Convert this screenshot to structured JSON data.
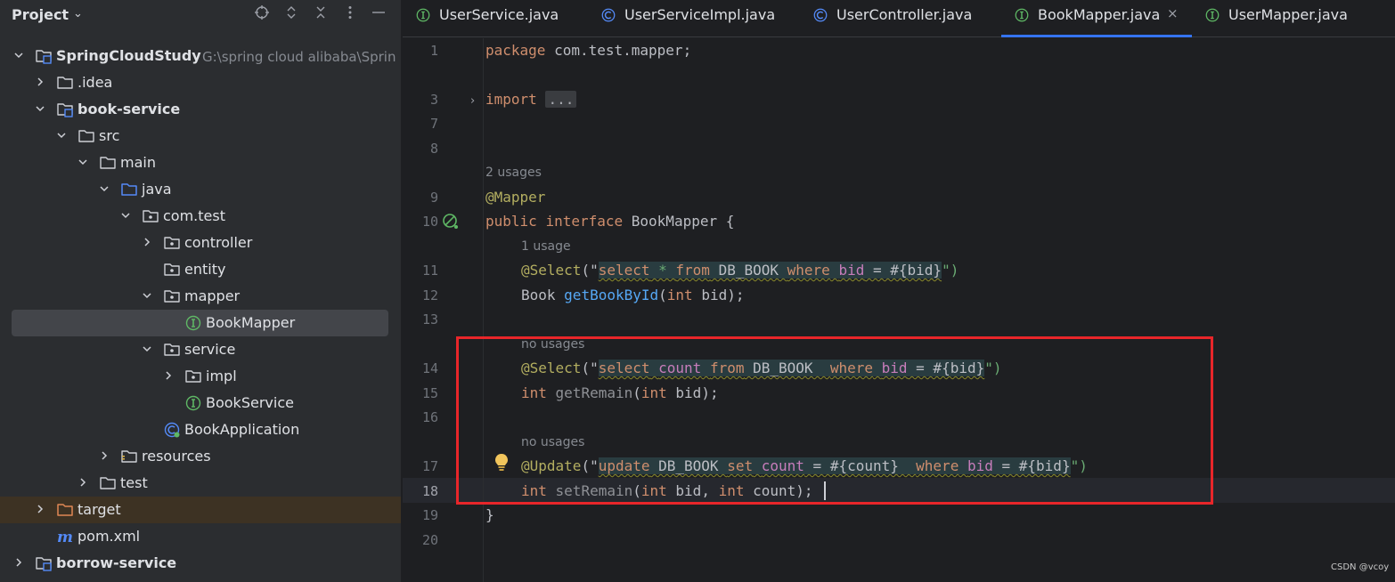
{
  "project_panel": {
    "title": "Project",
    "header_icons": [
      "locate-icon",
      "expand-all-icon",
      "collapse-all-icon",
      "more-options-icon",
      "hide-panel-icon"
    ],
    "tree": [
      {
        "label": "SpringCloudStudy",
        "path": "G:\\spring cloud alibaba\\Sprin",
        "icon": "module-folder-icon",
        "expanded": true,
        "bold": true
      },
      {
        "label": ".idea",
        "icon": "folder-icon",
        "expanded": false
      },
      {
        "label": "book-service",
        "icon": "module-folder-icon",
        "expanded": true,
        "bold": true
      },
      {
        "label": "src",
        "icon": "folder-icon",
        "expanded": true
      },
      {
        "label": "main",
        "icon": "folder-icon",
        "expanded": true
      },
      {
        "label": "java",
        "icon": "source-folder-icon",
        "expanded": true
      },
      {
        "label": "com.test",
        "icon": "package-icon",
        "expanded": true
      },
      {
        "label": "controller",
        "icon": "package-icon",
        "expanded": false
      },
      {
        "label": "entity",
        "icon": "package-icon"
      },
      {
        "label": "mapper",
        "icon": "package-icon",
        "expanded": true
      },
      {
        "label": "BookMapper",
        "icon": "interface-icon",
        "selected": true
      },
      {
        "label": "service",
        "icon": "package-icon",
        "expanded": true
      },
      {
        "label": "impl",
        "icon": "package-icon",
        "expanded": false
      },
      {
        "label": "BookService",
        "icon": "interface-icon"
      },
      {
        "label": "BookApplication",
        "icon": "spring-boot-class-icon"
      },
      {
        "label": "resources",
        "icon": "resources-folder-icon",
        "expanded": false
      },
      {
        "label": "test",
        "icon": "folder-icon",
        "expanded": false
      },
      {
        "label": "target",
        "icon": "excluded-folder-icon",
        "expanded": false,
        "excluded": true
      },
      {
        "label": "pom.xml",
        "icon": "maven-icon"
      },
      {
        "label": "borrow-service",
        "icon": "module-folder-icon",
        "expanded": false,
        "bold": true
      }
    ]
  },
  "tabs": [
    {
      "label": "UserService.java",
      "icon": "interface-icon"
    },
    {
      "label": "UserServiceImpl.java",
      "icon": "class-icon"
    },
    {
      "label": "UserController.java",
      "icon": "class-icon"
    },
    {
      "label": "BookMapper.java",
      "icon": "interface-icon",
      "active": true,
      "close": "×"
    },
    {
      "label": "UserMapper.java",
      "icon": "interface-icon"
    }
  ],
  "editor": {
    "hints": {
      "mapper_usages": "2 usages",
      "select_usages": "1 usage",
      "remain_usages": "no usages",
      "update_usages": "no usages"
    },
    "line_numbers": [
      "1",
      "3",
      "7",
      "8",
      "9",
      "10",
      "11",
      "12",
      "13",
      "14",
      "15",
      "16",
      "17",
      "18",
      "19",
      "20"
    ],
    "current_line": "18",
    "code": {
      "l1_kw": "package",
      "l1_rest": " com.test.mapper;",
      "l3_kw": "import",
      "l3_fold": "...",
      "l9": "@Mapper",
      "l10_kw1": "public",
      "l10_kw2": "interface",
      "l10_rest": " BookMapper {",
      "l11_ann": "@Select",
      "l11_open": "(\"",
      "l11_s1": "select",
      "l11_s2": " * ",
      "l11_s3": "from",
      "l11_s4": " DB_BOOK ",
      "l11_s5": "where",
      "l11_s6": " ",
      "l11_s7": "bid",
      "l11_s8": " = #{bid}",
      "l11_close": "\")",
      "l12_type": "Book ",
      "l12_fn": "getBookById",
      "l12_p1": "(",
      "l12_kw": "int",
      "l12_p2": " bid);",
      "l14_ann": "@Select",
      "l14_open": "(\"",
      "l14_s1": "select",
      "l14_s2": " ",
      "l14_s3": "count",
      "l14_s4": " ",
      "l14_s5": "from",
      "l14_s6": " DB_BOOK  ",
      "l14_s7": "where",
      "l14_s8": " ",
      "l14_s9": "bid",
      "l14_s10": " = #{bid}",
      "l14_close": "\")",
      "l15_kw": "int",
      "l15_fn": " getRemain",
      "l15_p1": "(",
      "l15_kw2": "int",
      "l15_p2": " bid);",
      "l17_ann": "@Update",
      "l17_open": "(\"",
      "l17_s1": "update",
      "l17_s2": " DB_BOOK ",
      "l17_s3": "set",
      "l17_s4": " ",
      "l17_s5": "count",
      "l17_s6": " = #{count}  ",
      "l17_s7": "where",
      "l17_s8": " ",
      "l17_s9": "bid",
      "l17_s10": " = #{bid}",
      "l17_close": "\")",
      "l18_kw": "int",
      "l18_fn": " setRemain",
      "l18_p1": "(",
      "l18_kw2": "int",
      "l18_p2": " bid, ",
      "l18_kw3": "int",
      "l18_p3": " count);",
      "l19": "}"
    }
  },
  "colors": {
    "highlight_box": "#e8262a",
    "active_tab_underline": "#3574f0",
    "keyword": "#cf8e6d",
    "annotation": "#b3ae60",
    "string": "#6aab73"
  },
  "watermark": "CSDN @vcoy"
}
